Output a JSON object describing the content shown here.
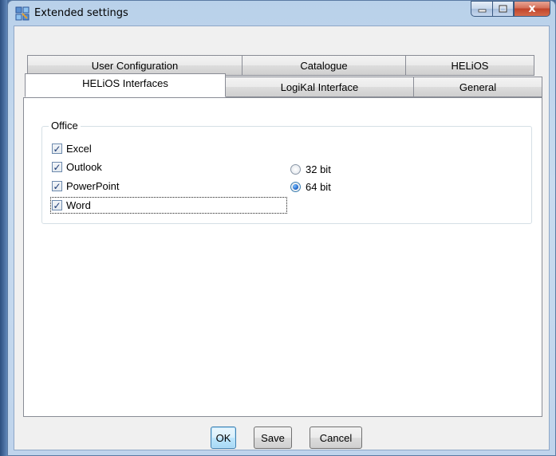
{
  "window": {
    "title": "Extended settings",
    "close_glyph": "x"
  },
  "tabs": {
    "row_back": [
      {
        "label": "User Configuration"
      },
      {
        "label": "Catalogue"
      },
      {
        "label": "HELiOS"
      }
    ],
    "row_front": [
      {
        "label": "HELiOS Interfaces",
        "selected": true
      },
      {
        "label": "LogiKal Interface",
        "selected": false
      },
      {
        "label": "General",
        "selected": false
      }
    ]
  },
  "office_group": {
    "legend": "Office",
    "apps": [
      {
        "label": "Excel",
        "checked": true
      },
      {
        "label": "Outlook",
        "checked": true
      },
      {
        "label": "PowerPoint",
        "checked": true
      },
      {
        "label": "Word",
        "checked": true
      }
    ],
    "bitness": [
      {
        "label": "32 bit",
        "selected": false
      },
      {
        "label": "64 bit",
        "selected": true
      }
    ]
  },
  "buttons": {
    "ok": "OK",
    "save": "Save",
    "cancel": "Cancel"
  },
  "colors": {
    "accent": "#3c7fb1",
    "close_button": "#c0442a",
    "frame": "#b9d1ea"
  }
}
